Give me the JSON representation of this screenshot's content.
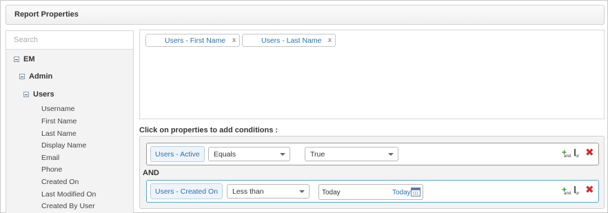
{
  "header": {
    "title": "Report Properties"
  },
  "sidebar": {
    "search_placeholder": "Search",
    "tree": {
      "root": "EM",
      "child": "Admin",
      "grandchild": "Users",
      "leaves": [
        "Username",
        "First Name",
        "Last Name",
        "Display Name",
        "Email",
        "Phone",
        "Created On",
        "Last Modified On",
        "Created By User"
      ]
    }
  },
  "selected_fields": [
    {
      "label": "Users - First Name",
      "remove": "x"
    },
    {
      "label": "Users - Last Name",
      "remove": "x"
    }
  ],
  "conditions_label": "Click on properties to add conditions :",
  "conditions": [
    {
      "property": "Users - Active",
      "operator": "Equals",
      "value": "True"
    },
    {
      "property": "Users - Created On",
      "operator": "Less than",
      "value": "Today",
      "date_link": "Today"
    }
  ],
  "joiner": "AND",
  "icons": {
    "add_and": "add-and-icon",
    "add_or": "add-or-icon",
    "delete": "delete-icon",
    "calendar": "calendar-icon",
    "tree_toggle": "collapse-icon"
  },
  "action_labels": {
    "and_sub": "and",
    "or_sub": "or"
  },
  "colors": {
    "link": "#2c6fb3",
    "add": "#2e9a2e",
    "delete": "#d8262b",
    "active_row_border": "#5aa6c9"
  }
}
